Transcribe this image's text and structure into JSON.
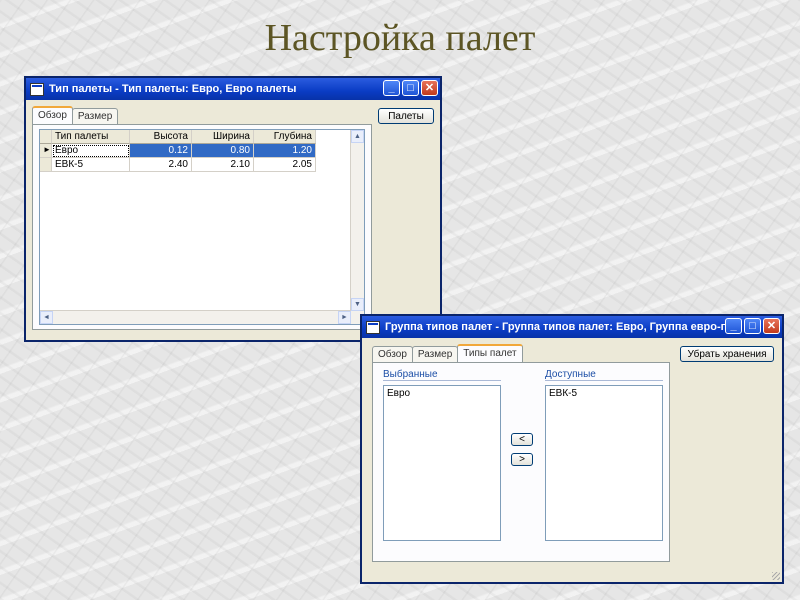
{
  "slide": {
    "title": "Настройка палет"
  },
  "window1": {
    "title": "Тип палеты - Тип палеты: Евро, Евро палеты",
    "tabs": [
      "Обзор",
      "Размер"
    ],
    "button_label": "Палеты",
    "columns": [
      "Тип палеты",
      "Высота",
      "Ширина",
      "Глубина"
    ],
    "rows": [
      {
        "name": "Евро",
        "height": "0.12",
        "width": "0.80",
        "depth": "1.20"
      },
      {
        "name": "ЕВК-5",
        "height": "2.40",
        "width": "2.10",
        "depth": "2.05"
      }
    ]
  },
  "window2": {
    "title": "Группа типов палет - Группа типов палет: Евро, Группа евро-палет",
    "tabs": [
      "Обзор",
      "Размер",
      "Типы палет"
    ],
    "button_label": "Убрать хранения",
    "selected_label": "Выбранные",
    "available_label": "Доступные",
    "selected_items": [
      "Евро"
    ],
    "available_items": [
      "ЕВК-5"
    ],
    "move_left": "<",
    "move_right": ">"
  }
}
